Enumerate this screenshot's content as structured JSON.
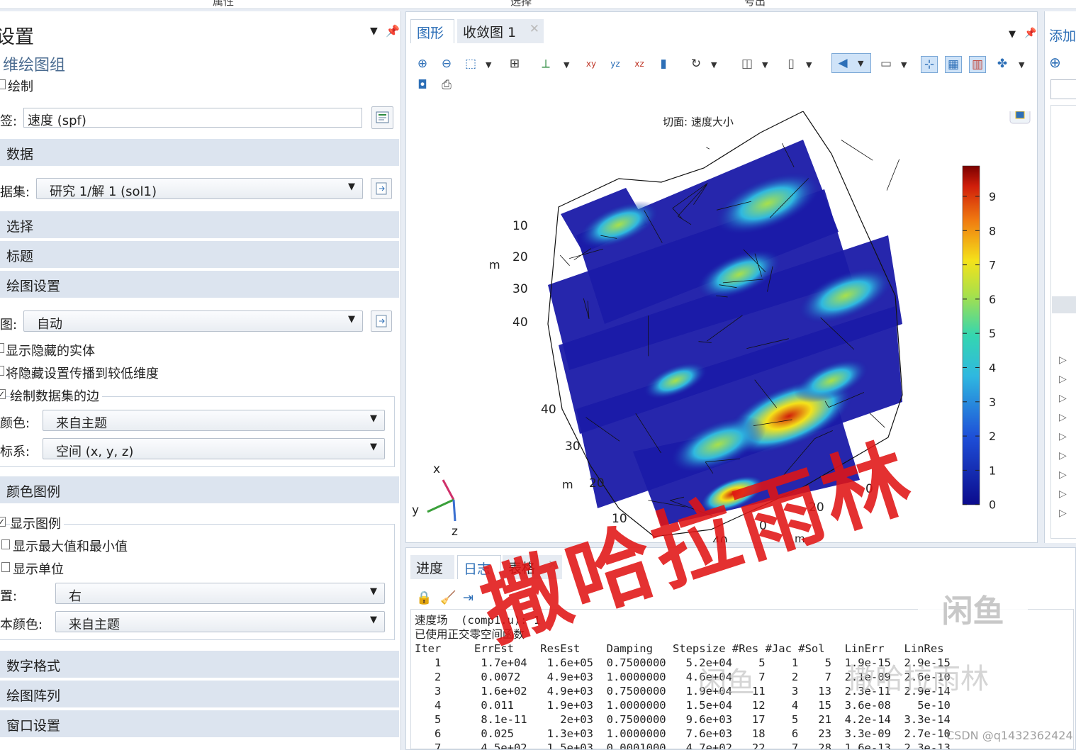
{
  "top": {
    "items": [
      "属性",
      "选择",
      "号出"
    ]
  },
  "settings": {
    "title": "设置",
    "subtitle": "维绘图组",
    "plot_button": "绘制",
    "label_caption": "签:",
    "label_value": "速度 (spf)",
    "sections": {
      "data": "数据",
      "selection": "选择",
      "title": "标题",
      "plot_settings": "绘图设置",
      "color_legend": "颜色图例",
      "number_format": "数字格式",
      "plot_array": "绘图阵列",
      "window_settings": "窗口设置"
    },
    "dataset_caption": "据集:",
    "dataset_value": "研究 1/解 1 (sol1)",
    "view_caption": "图:",
    "view_value": "自动",
    "show_hidden": "显示隐藏的实体",
    "propagate_hidden": "将隐藏设置传播到较低维度",
    "plot_edges": "绘制数据集的边",
    "color_caption": "颜色:",
    "color_value": "来自主题",
    "frame_caption": "标系:",
    "frame_value": "空间  (x, y, z)",
    "show_legend": "显示图例",
    "show_maxmin": "显示最大值和最小值",
    "show_units": "显示单位",
    "position_caption": "置:",
    "position_value": "右",
    "text_color_caption": "本颜色:",
    "text_color_value": "来自主题"
  },
  "graphics": {
    "tab_graphics": "图形",
    "tab_convergence": "收敛图 1",
    "plot_title": "切面: 速度大小",
    "axis_m_left": "m",
    "axis_m_bottom": "m",
    "yticks_left": [
      "10",
      "20",
      "30",
      "40"
    ],
    "yticks_bottom": [
      "40",
      "30",
      "20",
      "10"
    ],
    "extra_ticks": [
      "0",
      "20",
      "40",
      "m",
      "0"
    ],
    "triad": {
      "x": "x",
      "y": "y",
      "z": "z"
    },
    "colorbar_ticks": [
      "9",
      "8",
      "7",
      "6",
      "5",
      "4",
      "3",
      "2",
      "1",
      "0"
    ],
    "colors": {
      "high": "#7a0000",
      "mid_high": "#e63a00",
      "mid": "#f4e21a",
      "mid_low": "#36d8d8",
      "low": "#1a1aa8"
    }
  },
  "log": {
    "tab_progress": "进度",
    "tab_log": "日志",
    "tab_table": "表格",
    "line1": "速度场  (comp1.u): 1",
    "line2": "已使用正交零空间函数",
    "header": "Iter     ErrEst    ResEst    Damping   Stepsize #Res #Jac #Sol   LinErr   LinRes",
    "rows": [
      "   1      1.7e+04   1.6e+05  0.7500000   5.2e+04    5    1    5  1.9e-15  2.9e-15",
      "   2      0.0072    4.9e+03  1.0000000   4.6e+04    7    2    7  2.1e-09  2.6e-10",
      "   3      1.6e+02   4.9e+03  0.7500000   1.9e+04   11    3   13  2.3e-11  2.9e-14",
      "   4      0.011     1.9e+03  1.0000000   1.5e+04   12    4   15  3.6e-08    5e-10",
      "   5      8.1e-11     2e+03  0.7500000   9.6e+03   17    5   21  4.2e-14  3.3e-14",
      "   6      0.025     1.3e+03  1.0000000   7.6e+03   18    6   23  3.3e-09  2.7e-10",
      "   7      4.5e+02   1.5e+03  0.0001000   4.7e+02   22    7   28  1.6e-13  2.3e-13"
    ]
  },
  "right": {
    "tab": "添加"
  },
  "watermarks": {
    "red": "撒哈拉雨林",
    "xianyu": "闲鱼",
    "grey1": "闲鱼",
    "grey2": "撒哈拉雨林",
    "csdn": "CSDN @q1432362424"
  }
}
